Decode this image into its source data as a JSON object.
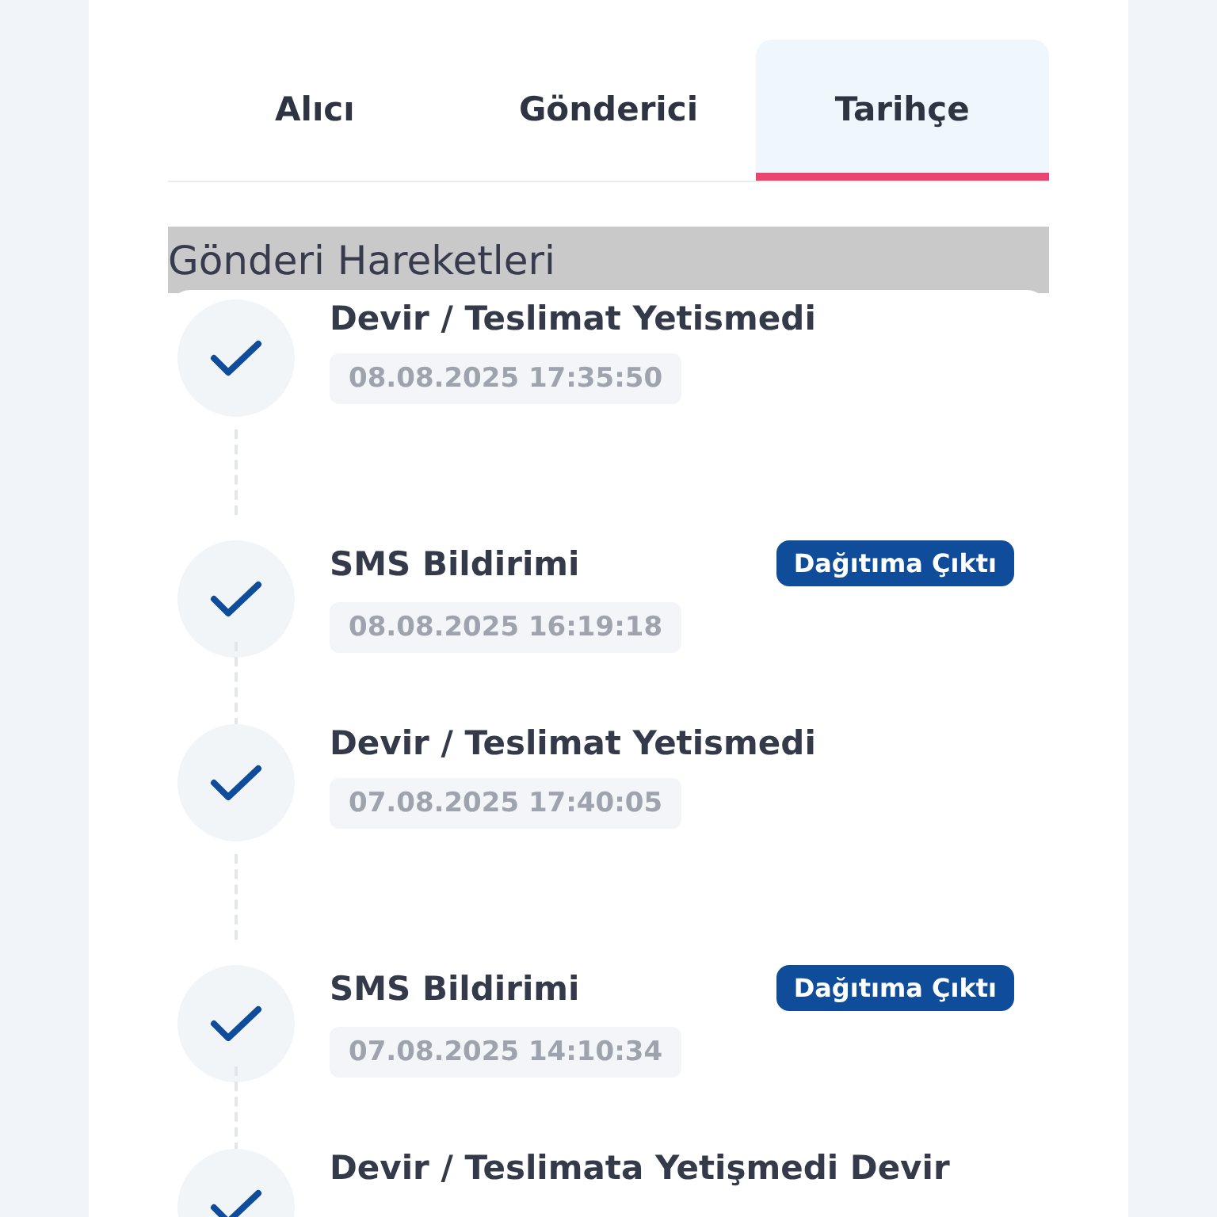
{
  "tabs": [
    {
      "label": "Alıcı",
      "selected": false
    },
    {
      "label": "Gönderici",
      "selected": false
    },
    {
      "label": "Tarihçe",
      "selected": true
    }
  ],
  "section_title": "Gönderi Hareketleri",
  "events": [
    {
      "title": "Devir / Teslimat Yetismedi",
      "date": "08.08.2025 17:35:50",
      "done": true
    },
    {
      "title": "SMS Bildirimi",
      "badge": "Dağıtıma Çıktı",
      "date": "08.08.2025 16:19:18",
      "done": true
    },
    {
      "title": "Devir / Teslimat Yetismedi",
      "date": "07.08.2025 17:40:05",
      "done": true
    },
    {
      "title": "SMS Bildirimi",
      "badge": "Dağıtıma Çıktı",
      "date": "07.08.2025 14:10:34",
      "done": true
    },
    {
      "title": "Devir / Teslimata Yetişmedi Devir",
      "done": true
    }
  ]
}
